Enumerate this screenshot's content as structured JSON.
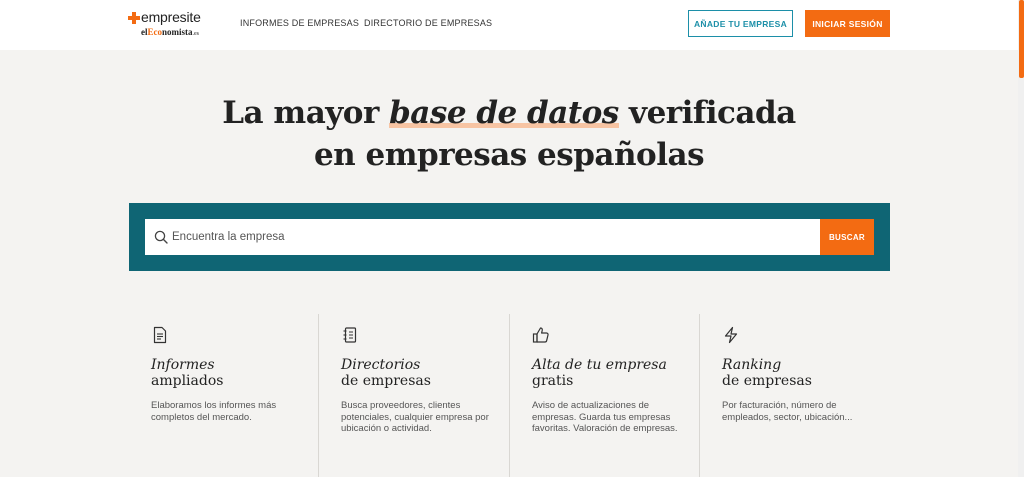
{
  "header": {
    "logo_name": "empresite",
    "logo_sub_pre": "el",
    "logo_sub_hl": "Eco",
    "logo_sub_post": "nomista",
    "logo_sub_tail": ".es",
    "nav": [
      "INFORMES DE EMPRESAS",
      "DIRECTORIO DE EMPRESAS"
    ],
    "add_company_label": "AÑADE TU EMPRESA",
    "login_label": "INICIAR SESIÓN"
  },
  "hero": {
    "title_part1": "La mayor ",
    "title_em": "base de datos",
    "title_part2": " verificada",
    "title_line2": "en empresas españolas"
  },
  "search": {
    "placeholder": "Encuentra la empresa",
    "button_label": "BUSCAR"
  },
  "features": [
    {
      "icon": "document-icon",
      "title_l1": "Informes",
      "title_l2": "ampliados",
      "desc": "Elaboramos los informes más completos del mercado."
    },
    {
      "icon": "directory-icon",
      "title_l1": "Directorios",
      "title_l2": "de empresas",
      "desc": "Busca proveedores, clientes potenciales, cualquier empresa por ubicación o actividad."
    },
    {
      "icon": "thumbs-up-icon",
      "title_l1": "Alta de tu empresa",
      "title_l2": "gratis",
      "desc": "Aviso de actualizaciones de empresas. Guarda tus empresas favoritas. Valoración de empresas."
    },
    {
      "icon": "lightning-icon",
      "title_l1": "Ranking",
      "title_l2": "de empresas",
      "desc": "Por facturación, número de empleados, sector, ubicación..."
    }
  ],
  "colors": {
    "accent": "#f36b12",
    "teal": "#0f6574",
    "outline_blue": "#1c8fa8",
    "background": "#f4f3f1"
  }
}
